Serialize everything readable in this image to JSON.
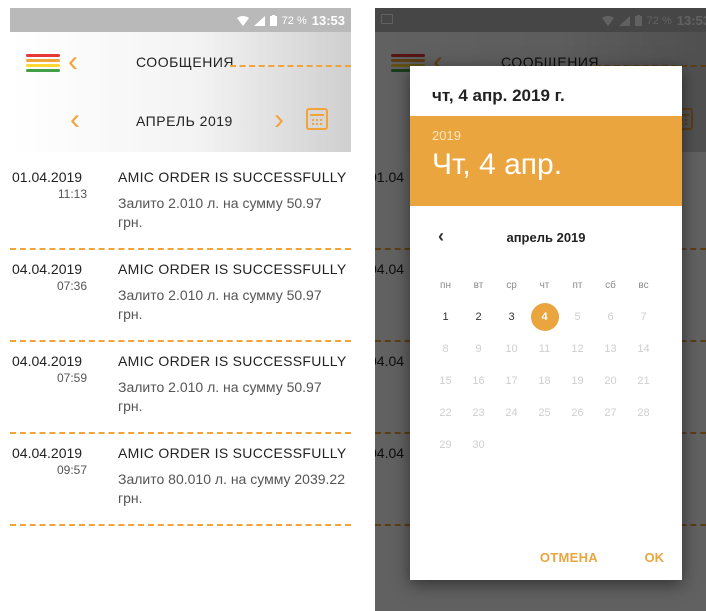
{
  "status_bar": {
    "battery": "72 %",
    "time": "13:53"
  },
  "app_bar": {
    "title": "СООБЩЕНИЯ",
    "month": "АПРЕЛЬ 2019",
    "menu_colors": [
      "#e53935",
      "#f0a43a",
      "#fdd835",
      "#43a047"
    ],
    "accent_color": "#f0a43a"
  },
  "messages": [
    {
      "date": "01.04.2019",
      "time": "11:13",
      "title": "AMIC ORDER IS SUCCESSFULLY",
      "body": "Залито 2.010 л. на сумму 50.97 грн."
    },
    {
      "date": "04.04.2019",
      "time": "07:36",
      "title": "AMIC ORDER IS SUCCESSFULLY",
      "body": "Залито 2.010 л. на сумму 50.97 грн."
    },
    {
      "date": "04.04.2019",
      "time": "07:59",
      "title": "AMIC ORDER IS SUCCESSFULLY",
      "body": "Залито 2.010 л. на сумму 50.97 грн."
    },
    {
      "date": "04.04.2019",
      "time": "09:57",
      "title": "AMIC ORDER IS SUCCESSFULLY",
      "body": "Залито 80.010 л. на сумму 2039.22 грн."
    }
  ],
  "right_peek": {
    "dates": [
      "01.04",
      "04.04",
      "04.04",
      "04.04"
    ],
    "tails": [
      "Y",
      "97",
      "Y",
      "97",
      "Y",
      "97",
      "Y"
    ]
  },
  "date_picker": {
    "header": "чт, 4 апр. 2019 г.",
    "year": "2019",
    "selected_date": "Чт, 4 апр.",
    "month": "апрель 2019",
    "weekdays": [
      "пн",
      "вт",
      "ср",
      "чт",
      "пт",
      "сб",
      "вс"
    ],
    "weeks": [
      [
        "1",
        "2",
        "3",
        "4",
        "5",
        "6",
        "7"
      ],
      [
        "8",
        "9",
        "10",
        "11",
        "12",
        "13",
        "14"
      ],
      [
        "15",
        "16",
        "17",
        "18",
        "19",
        "20",
        "21"
      ],
      [
        "22",
        "23",
        "24",
        "25",
        "26",
        "27",
        "28"
      ],
      [
        "29",
        "30",
        "",
        "",
        "",
        "",
        ""
      ]
    ],
    "selected_day": "4",
    "enabled_days": [
      "1",
      "2",
      "3",
      "4"
    ],
    "cancel_label": "ОТМЕНА",
    "ok_label": "OK",
    "accent_color": "#eaa53e"
  }
}
